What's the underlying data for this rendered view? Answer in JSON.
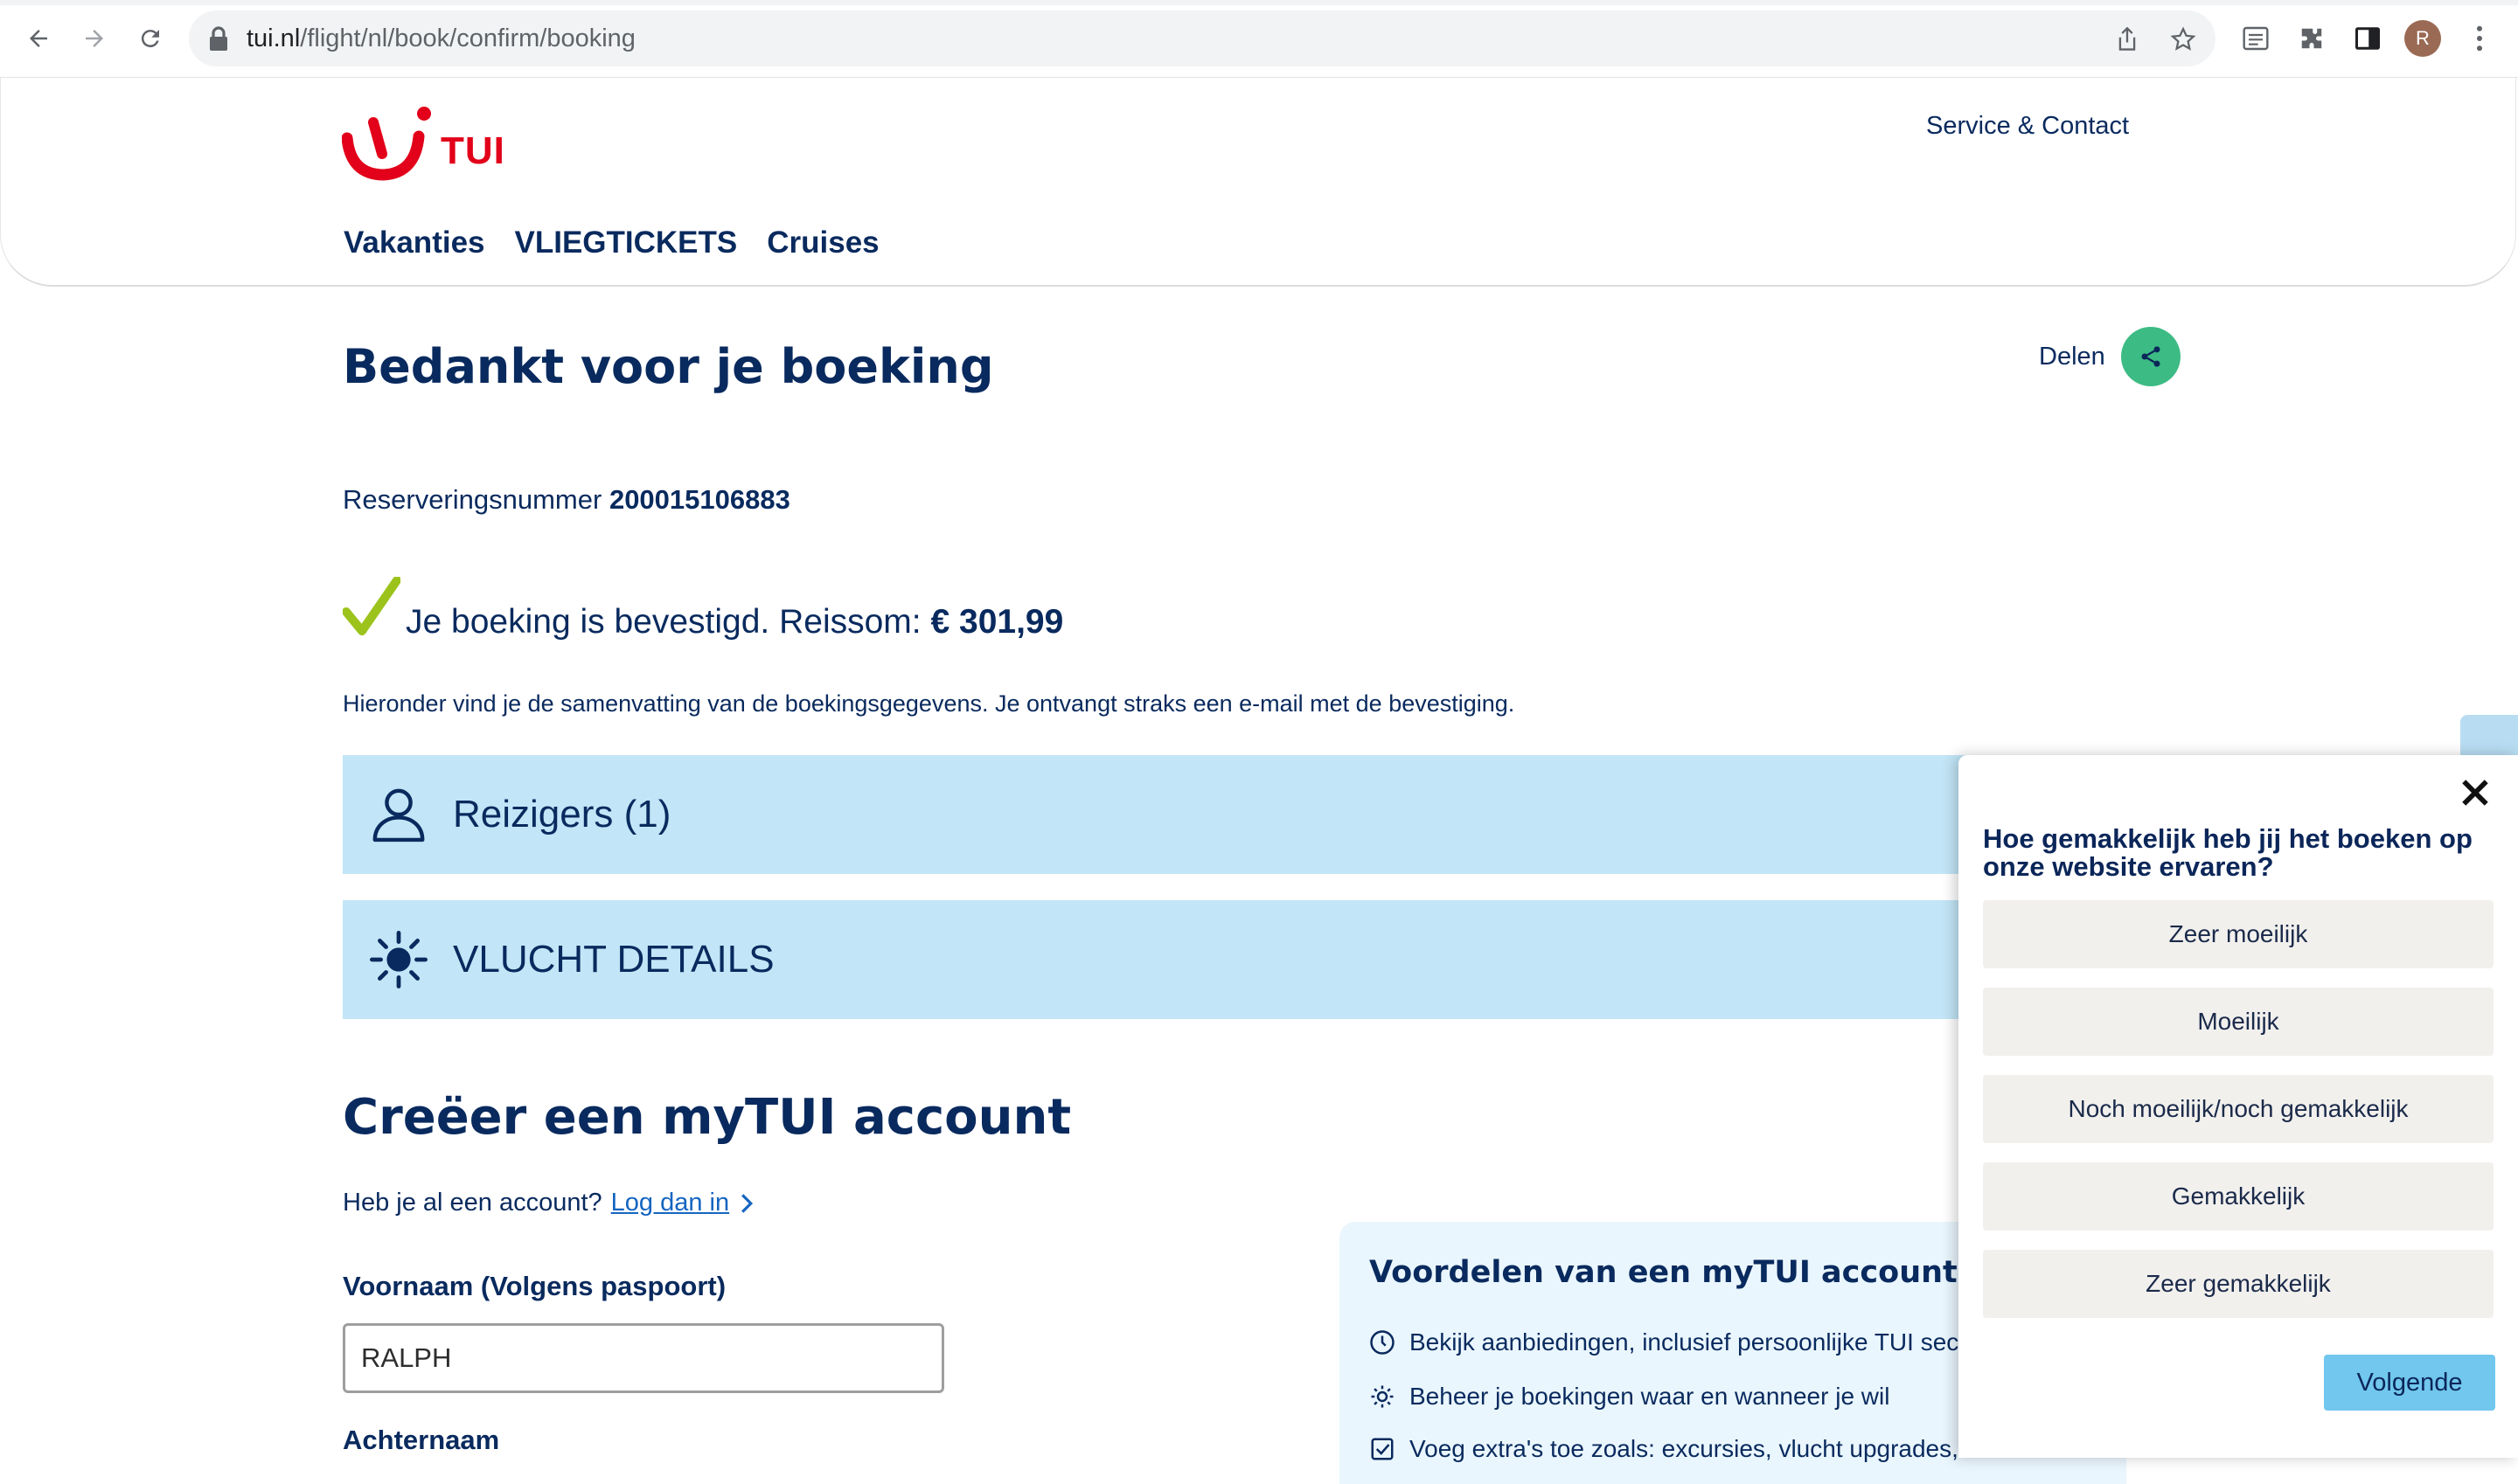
{
  "browser": {
    "url_host": "tui.nl",
    "url_path": "/flight/nl/book/confirm/booking",
    "profile_initial": "R"
  },
  "header": {
    "logo_text": "TUI",
    "service_link": "Service & Contact",
    "nav": [
      "Vakanties",
      "VLIEGTICKETS",
      "Cruises"
    ]
  },
  "main": {
    "title": "Bedankt voor je boeking",
    "share_label": "Delen",
    "reservation_label": "Reserveringsnummer",
    "reservation_number": "200015106883",
    "confirm_text": "Je boeking is bevestigd. Reissom:",
    "confirm_amount": "€ 301,99",
    "summary_text": "Hieronder vind je de samenvatting van de boekingsgegevens. Je ontvangt straks een e-mail met de bevestiging.",
    "sections": [
      {
        "label": "Reizigers (1)",
        "icon": "person-icon"
      },
      {
        "label": "VLUCHT DETAILS",
        "icon": "sun-icon"
      }
    ]
  },
  "account": {
    "title": "Creëer een myTUI account",
    "have_account_text": "Heb je al een account?",
    "login_link": "Log dan in",
    "first_name_label": "Voornaam (Volgens paspoort)",
    "first_name_value": "RALPH",
    "last_name_label": "Achternaam"
  },
  "benefits": {
    "title": "Voordelen van een myTUI account",
    "items": [
      {
        "text": "Bekijk aanbiedingen, inclusief persoonlijke TUI secr",
        "icon": "clock-icon"
      },
      {
        "text": "Beheer je boekingen waar en wanneer je wil",
        "icon": "gear-icon"
      },
      {
        "text": "Voeg extra's toe zoals: excursies, vlucht upgrades, e",
        "icon": "checkbox-icon"
      }
    ]
  },
  "feedback": {
    "question": "Hoe gemakkelijk heb jij het boeken op onze website ervaren?",
    "options": [
      "Zeer moeilijk",
      "Moeilijk",
      "Noch moeilijk/noch gemakkelijk",
      "Gemakkelijk",
      "Zeer gemakkelijk"
    ],
    "next_label": "Volgende"
  },
  "colors": {
    "brand_navy": "#092a5e",
    "brand_red": "#e2001a",
    "band_blue": "#c2e6f7",
    "share_green": "#3dbb84",
    "check_green": "#9cc31c",
    "next_button": "#71c7ee"
  }
}
